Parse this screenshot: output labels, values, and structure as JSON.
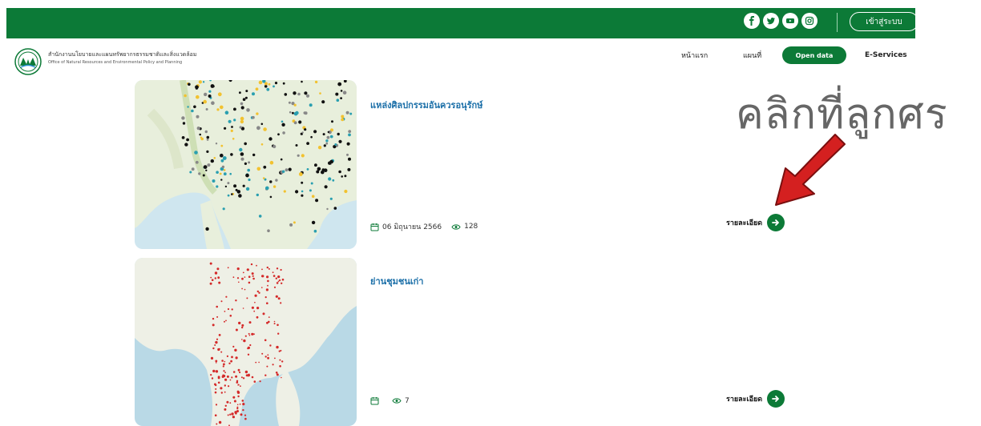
{
  "header": {
    "login_label": "เข้าสู่ระบบ",
    "org_name_th": "สำนักงานนโยบายและแผนทรัพยากรธรรมชาติและสิ่งแวดล้อม",
    "org_name_en": "Office of Natural Resources and Environmental Policy and Planning",
    "social_icons": [
      "facebook-icon",
      "twitter-icon",
      "youtube-icon",
      "instagram-icon"
    ]
  },
  "nav": {
    "home": "หน้าแรก",
    "map": "แผนที่",
    "open_data": "Open data",
    "eservices": "E-Services"
  },
  "cards": [
    {
      "title": "แหล่งศิลปกรรมอันควรอนุรักษ์",
      "date": "06 มิถุนายน 2566",
      "views": "128",
      "detail_label": "รายละเอียด"
    },
    {
      "title": "ย่านชุมชนเก่า",
      "date": "",
      "views": "7",
      "detail_label": "รายละเอียด"
    }
  ],
  "annotation": {
    "text": "คลิกที่ลูกศร"
  },
  "colors": {
    "brand_green": "#0c7a37",
    "title_blue": "#1b6fa8",
    "annotation_red": "#d42020"
  }
}
